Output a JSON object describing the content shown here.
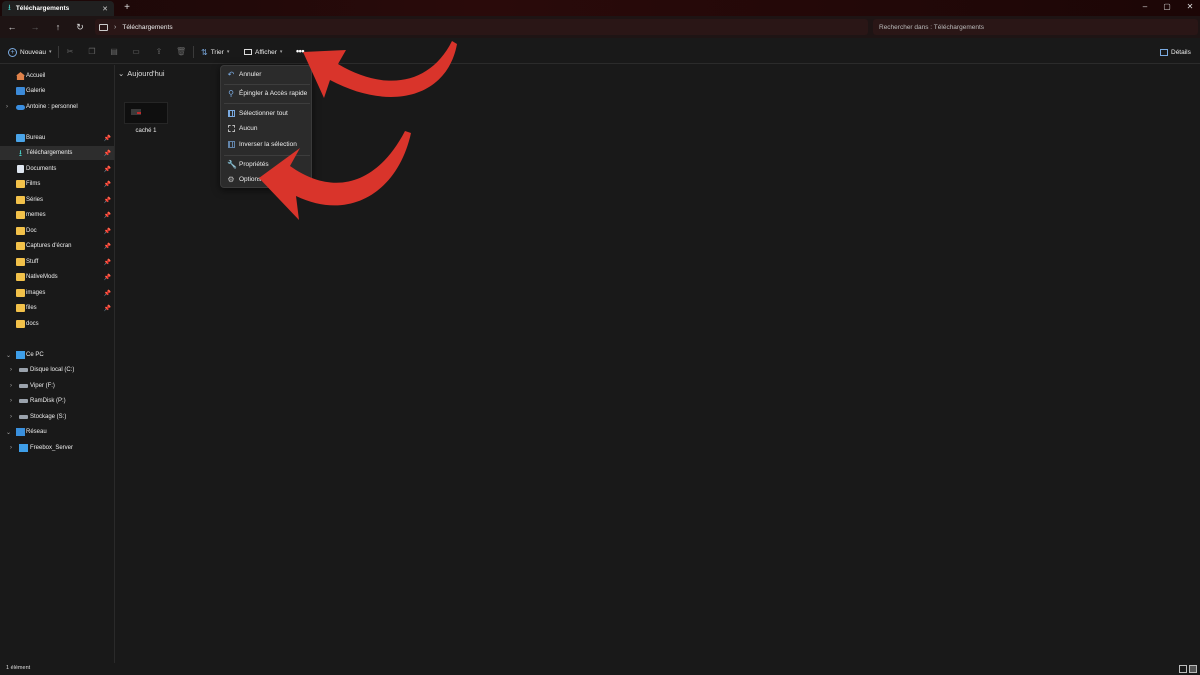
{
  "window": {
    "tab_title": "Téléchargements",
    "tab_close": "✕",
    "new_tab": "+",
    "minimize": "–",
    "maximize": "▢",
    "close": "✕"
  },
  "address": {
    "breadcrumb": "Téléchargements",
    "search_placeholder": "Rechercher dans : Téléchargements"
  },
  "toolbar": {
    "new_label": "Nouveau",
    "sort_label": "Trier",
    "view_label": "Afficher",
    "more_label": "•••",
    "details_label": "Détails"
  },
  "sidebar": {
    "top": [
      {
        "label": "Accueil",
        "icon": "home-icon"
      },
      {
        "label": "Galerie",
        "icon": "gallery-icon"
      },
      {
        "label": "Antoine : personnel",
        "icon": "onedrive-icon"
      }
    ],
    "quick": [
      {
        "label": "Bureau",
        "icon": "desktop-folder-icon"
      },
      {
        "label": "Téléchargements",
        "icon": "downloads-icon",
        "selected": true
      },
      {
        "label": "Documents",
        "icon": "documents-icon"
      },
      {
        "label": "Films",
        "icon": "folder-icon"
      },
      {
        "label": "Séries",
        "icon": "folder-icon"
      },
      {
        "label": "memes",
        "icon": "folder-icon"
      },
      {
        "label": "Doc",
        "icon": "folder-icon"
      },
      {
        "label": "Captures d'écran",
        "icon": "folder-icon"
      },
      {
        "label": "Stuff",
        "icon": "folder-icon"
      },
      {
        "label": "NativeMods",
        "icon": "folder-icon"
      },
      {
        "label": "images",
        "icon": "folder-icon"
      },
      {
        "label": "files",
        "icon": "folder-icon"
      },
      {
        "label": "docs",
        "icon": "folder-icon"
      }
    ],
    "this_pc": "Ce PC",
    "drives": [
      {
        "label": "Disque local (C:)"
      },
      {
        "label": "Viper (F:)"
      },
      {
        "label": "RamDisk (P:)"
      },
      {
        "label": "Stockage (S:)"
      }
    ],
    "network": "Réseau",
    "network_items": [
      {
        "label": "Freebox_Server"
      }
    ]
  },
  "content": {
    "group_header": "Aujourd'hui",
    "files": [
      {
        "name": "caché 1"
      }
    ]
  },
  "menu": {
    "items": [
      {
        "label": "Annuler",
        "icon": "undo-icon"
      },
      {
        "label": "Épingler à Accès rapide",
        "icon": "pin-icon"
      },
      {
        "label": "Sélectionner tout",
        "icon": "select-all-icon"
      },
      {
        "label": "Aucun",
        "icon": "select-none-icon"
      },
      {
        "label": "Inverser la sélection",
        "icon": "invert-selection-icon"
      },
      {
        "label": "Propriétés",
        "icon": "properties-icon"
      },
      {
        "label": "Options",
        "icon": "options-icon"
      }
    ]
  },
  "status": {
    "count": "1 élément"
  },
  "colors": {
    "arrow": "#d9342b",
    "accent": "#7aaae0"
  }
}
